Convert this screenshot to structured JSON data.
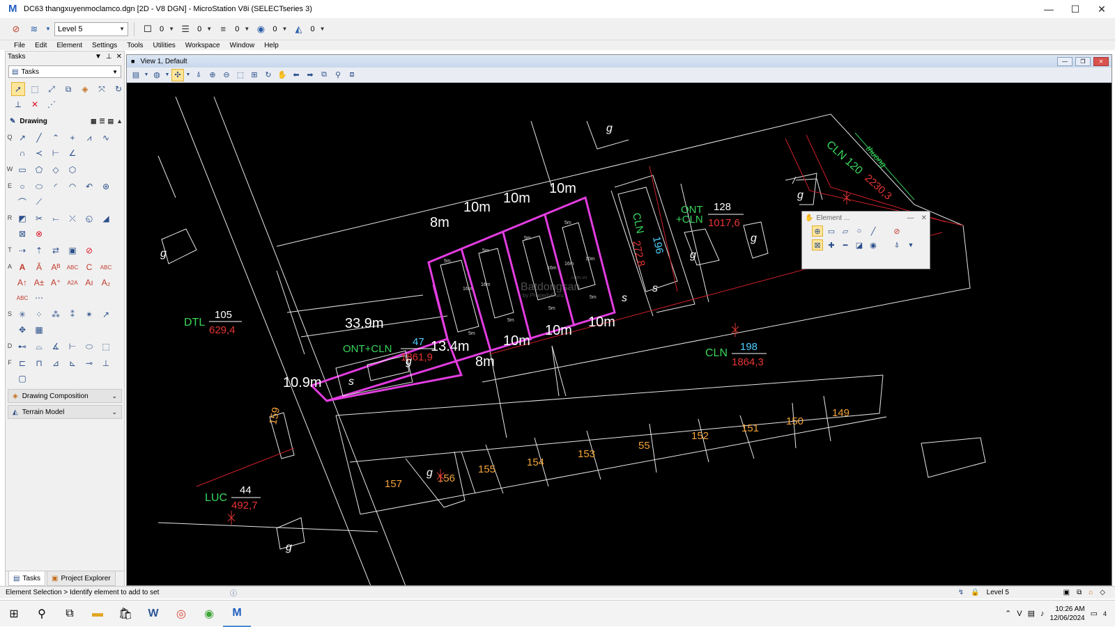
{
  "window": {
    "title": "DC63 thangxuyenmoclamco.dgn [2D - V8 DGN] - MicroStation V8i (SELECTseries 3)",
    "minimize": "—",
    "maximize": "☐",
    "close": "✕"
  },
  "toolbar": {
    "level": "Level 5",
    "color_value": "0",
    "style_value": "0",
    "weight_value": "0",
    "transparency_value": "0",
    "priority_value": "0"
  },
  "menu": [
    "File",
    "Edit",
    "Element",
    "Settings",
    "Tools",
    "Utilities",
    "Workspace",
    "Window",
    "Help"
  ],
  "tasks_panel": {
    "header": "Tasks",
    "selector": "Tasks",
    "drawing_section": "Drawing",
    "row_keys": [
      "Q",
      "W",
      "E",
      "R",
      "T",
      "A",
      "S",
      "D",
      "F"
    ],
    "collapsed_sections": [
      "Drawing Composition",
      "Terrain Model"
    ],
    "tabs": [
      "Tasks",
      "Project Explorer"
    ]
  },
  "view": {
    "title": "View 1, Default",
    "watermark": "Batdongsan",
    "watermark_sub": "by PropertyGuru",
    "watermark_url": ".com.vn"
  },
  "cad": {
    "dims": {
      "d8a": "8m",
      "d10a": "10m",
      "d10b": "10m",
      "d10c": "10m",
      "d339": "33.9m",
      "d134": "13.4m",
      "d109": "10.9m",
      "d8b": "8m",
      "d10d": "10m",
      "d10e": "10m",
      "d10f": "10m"
    },
    "small": {
      "s5m": "5m",
      "s16m": "16m",
      "s10m": "10m"
    },
    "parcels": {
      "dtl_code": "DTL",
      "dtl_num": "105",
      "dtl_area": "629,4",
      "ontcln47_code": "ONT+CLN",
      "ontcln47_num": "47",
      "ontcln47_area": "1861,9",
      "ont128_code1": "ONT",
      "ont128_code2": "+CLN",
      "ont128_num": "128",
      "ont128_area": "1017,6",
      "cln196_code": "CLN",
      "cln196_num": "196",
      "cln196_area": "272,8",
      "cln120_text": "CLN 120",
      "cln120_area": "2230,3",
      "cln198_code": "CLN",
      "cln198_num": "198",
      "cln198_area": "1864,3",
      "luc_code": "LUC",
      "luc_num": "44",
      "luc_area": "492,7",
      "road_label": "thuong"
    },
    "lot_numbers": [
      "159",
      "157",
      "156",
      "155",
      "154",
      "153",
      "55",
      "152",
      "151",
      "150",
      "149"
    ],
    "letters": {
      "g": "g",
      "s": "s"
    }
  },
  "element_dialog": {
    "title": "Element ...",
    "min": "—",
    "close": "✕"
  },
  "status": {
    "message": "Element Selection > Identify element to add to set",
    "level": "Level 5"
  },
  "taskbar": {
    "time": "10:26 AM",
    "date": "12/06/2024",
    "notifications": "4"
  }
}
